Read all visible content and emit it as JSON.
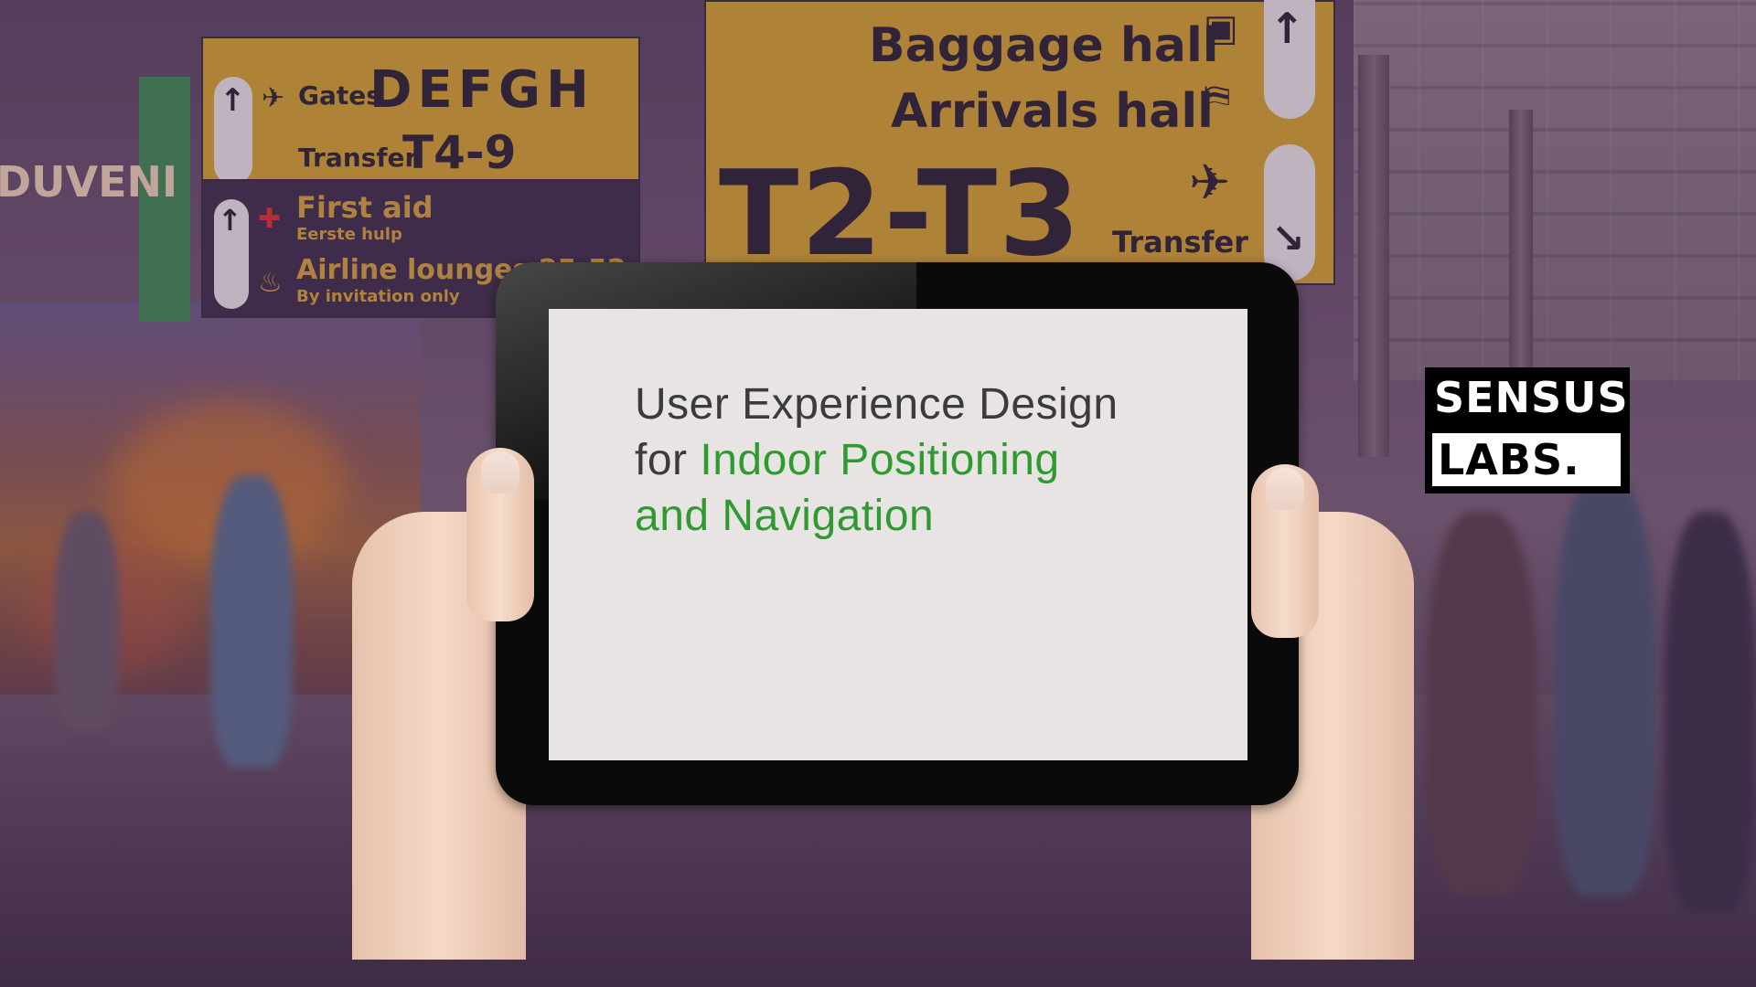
{
  "screen": {
    "title_line1": "User Experience Design",
    "title_for": "for ",
    "title_accent_1": "Indoor Positioning",
    "title_accent_2": "and Navigation",
    "accent_color": "#2f9a2f"
  },
  "logo": {
    "top_text": "SENSUS",
    "bottom_text": "LABS."
  },
  "signs": {
    "gates_label": "Gates",
    "gates_value": "DEFGH",
    "transfer_label": "Transfer",
    "transfer_value": "T4-9",
    "first_aid": "First aid",
    "first_aid_sub": "Eerste hulp",
    "lounges": "Airline lounges 25-52",
    "lounges_sub": "By invitation only",
    "baggage": "Baggage hall",
    "arrivals": "Arrivals hall",
    "terminal": "T2-T3",
    "terminal_transfer": "Transfer",
    "shop_text": "DUVENI"
  }
}
